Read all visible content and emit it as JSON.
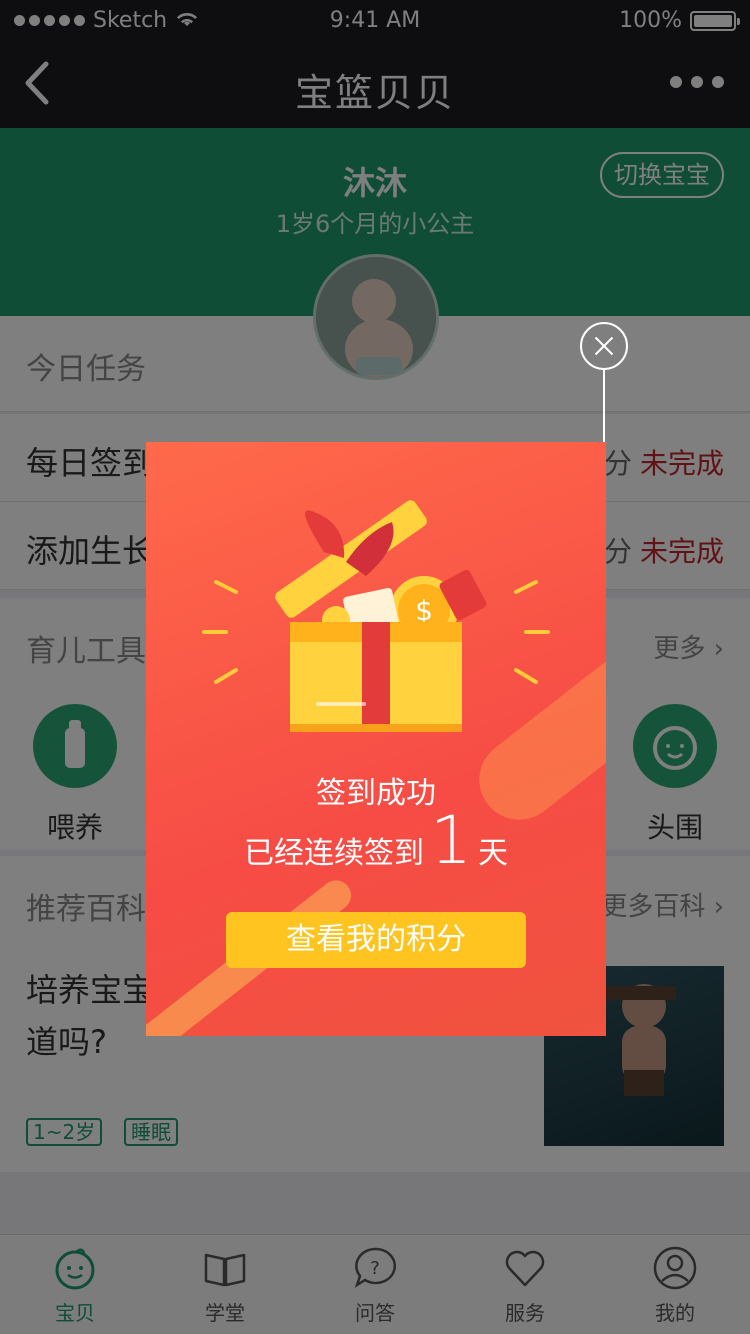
{
  "status_bar": {
    "carrier": "Sketch",
    "time": "9:41 AM",
    "battery": "100%"
  },
  "nav": {
    "title": "宝篮贝贝"
  },
  "profile": {
    "name": "沐沐",
    "subtitle": "1岁6个月的小公主",
    "switch_label": "切换宝宝"
  },
  "tasks": {
    "section_title": "今日任务",
    "items": [
      {
        "label": "每日签到",
        "points": "分",
        "state": "未完成"
      },
      {
        "label": "添加生长",
        "points": "分",
        "state": "未完成"
      }
    ]
  },
  "tools": {
    "section_title": "育儿工具",
    "more_label": "更多",
    "items": [
      {
        "label": "喂养"
      },
      {
        "label": "头围"
      }
    ]
  },
  "encyclopedia": {
    "section_title": "推荐百科",
    "more_label": "更多百科",
    "article_title": "培养宝宝\n道吗?",
    "tags": [
      "1~2岁",
      "睡眠"
    ]
  },
  "popup": {
    "line1": "签到成功",
    "line2_prefix": "已经连续签到",
    "days": "1",
    "line2_suffix": "天",
    "cta_label": "查看我的积分"
  },
  "tabbar": {
    "items": [
      {
        "label": "宝贝",
        "icon": "baby-face-icon",
        "active": true
      },
      {
        "label": "学堂",
        "icon": "book-icon"
      },
      {
        "label": "问答",
        "icon": "question-bubble-icon"
      },
      {
        "label": "服务",
        "icon": "heart-icon"
      },
      {
        "label": "我的",
        "icon": "user-icon"
      }
    ]
  },
  "colors": {
    "brand_green": "#1f9b6e",
    "popup_red": "#f64c45",
    "cta_yellow": "#ffc41f",
    "status_red": "#c1272d"
  }
}
